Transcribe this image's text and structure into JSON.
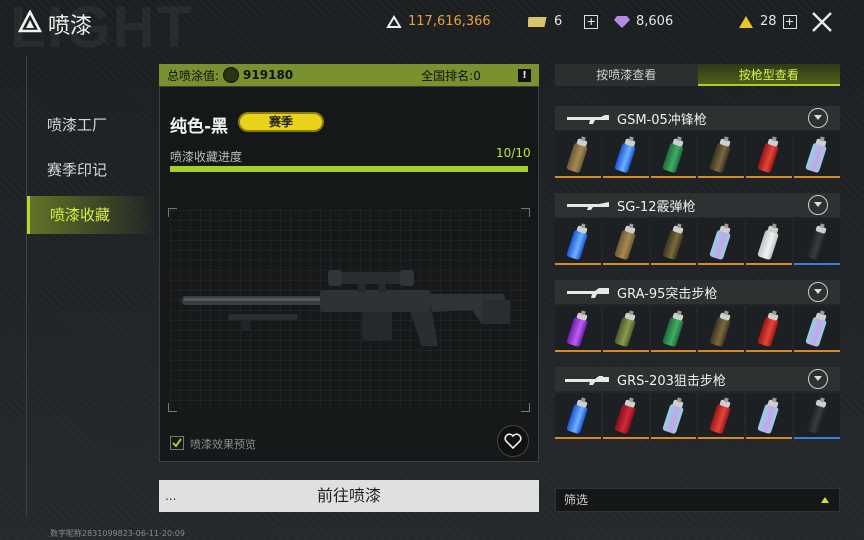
{
  "header": {
    "title": "喷漆",
    "watermark": "LIGHT",
    "currency_1": "117,616,366",
    "currency_2": "6",
    "currency_3": "8,606",
    "currency_4": "28"
  },
  "nav": {
    "items": [
      {
        "label": "喷漆工厂"
      },
      {
        "label": "赛季印记"
      },
      {
        "label": "喷漆收藏"
      }
    ],
    "active_index": 2
  },
  "stats": {
    "total_label": "总喷涂值:",
    "total_value": "919180",
    "rank_label": "全国排名:0"
  },
  "skin": {
    "name": "纯色-黑",
    "badge": "赛季",
    "progress_label": "喷漆收藏进度",
    "progress_text": "10/10",
    "progress_fraction": 1.0,
    "preview_label": "喷漆效果预览",
    "goto_label": "前往喷漆",
    "goto_dots": "..."
  },
  "tabs": [
    {
      "label": "按喷漆查看"
    },
    {
      "label": "按枪型查看"
    }
  ],
  "groups": [
    {
      "name": "GSM-05冲锋枪",
      "cans": [
        "camo-tan",
        "blue",
        "green",
        "camo-dark",
        "red",
        "pastel"
      ]
    },
    {
      "name": "SG-12霰弹枪",
      "cans": [
        "blue",
        "camo-tan",
        "camo-dark",
        "pastel",
        "white",
        "black"
      ]
    },
    {
      "name": "GRA-95突击步枪",
      "cans": [
        "purple",
        "camo-green",
        "green",
        "camo-dark",
        "red",
        "pastel"
      ]
    },
    {
      "name": "GRS-203狙击步枪",
      "cans": [
        "blue",
        "crimson",
        "pastel",
        "red",
        "pastel",
        "black"
      ]
    }
  ],
  "filter": {
    "label": "筛选"
  },
  "footer": {
    "text": "数字昵称2831099823-06-11-20:09"
  },
  "colors": {
    "accent": "#a8cf26",
    "currency_gold": "#e8a23a"
  }
}
